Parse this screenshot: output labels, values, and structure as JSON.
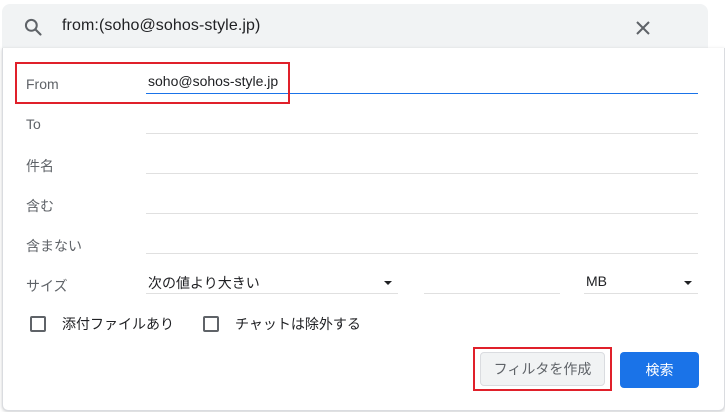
{
  "search": {
    "query": "from:(soho@sohos-style.jp)",
    "search_icon": "search-icon",
    "close_icon": "close-icon"
  },
  "form": {
    "from": {
      "label": "From",
      "value": "soho@sohos-style.jp"
    },
    "to": {
      "label": "To",
      "value": ""
    },
    "subject": {
      "label": "件名",
      "value": ""
    },
    "has_words": {
      "label": "含む",
      "value": ""
    },
    "doesnt_have": {
      "label": "含まない",
      "value": ""
    },
    "size": {
      "label": "サイズ",
      "comparator": "次の値より大きい",
      "value": "",
      "unit": "MB"
    },
    "has_attachment_label": "添付ファイルあり",
    "exclude_chats_label": "チャットは除外する"
  },
  "buttons": {
    "create_filter": "フィルタを作成",
    "search": "検索"
  },
  "colors": {
    "accent": "#1a73e8",
    "highlight": "#e0202a"
  }
}
